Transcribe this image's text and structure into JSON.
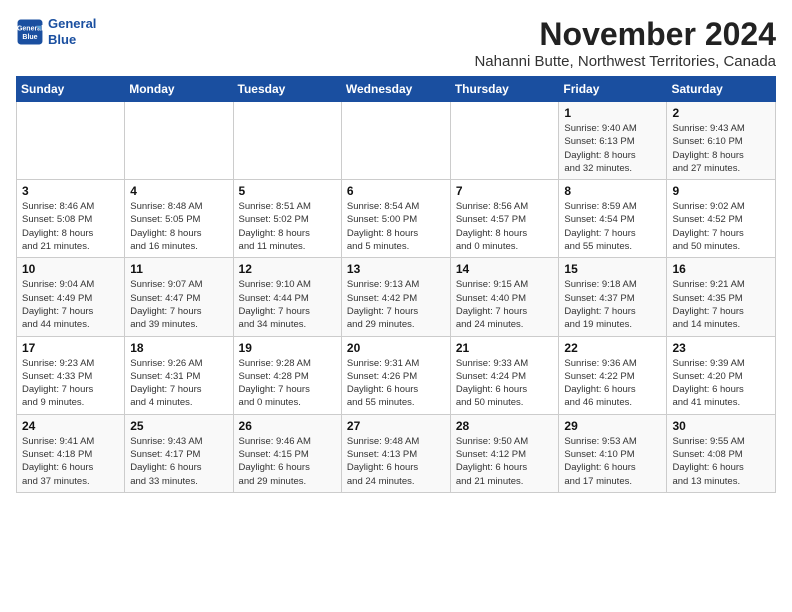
{
  "logo": {
    "line1": "General",
    "line2": "Blue"
  },
  "title": "November 2024",
  "subtitle": "Nahanni Butte, Northwest Territories, Canada",
  "weekdays": [
    "Sunday",
    "Monday",
    "Tuesday",
    "Wednesday",
    "Thursday",
    "Friday",
    "Saturday"
  ],
  "weeks": [
    [
      {
        "day": "",
        "info": ""
      },
      {
        "day": "",
        "info": ""
      },
      {
        "day": "",
        "info": ""
      },
      {
        "day": "",
        "info": ""
      },
      {
        "day": "",
        "info": ""
      },
      {
        "day": "1",
        "info": "Sunrise: 9:40 AM\nSunset: 6:13 PM\nDaylight: 8 hours\nand 32 minutes."
      },
      {
        "day": "2",
        "info": "Sunrise: 9:43 AM\nSunset: 6:10 PM\nDaylight: 8 hours\nand 27 minutes."
      }
    ],
    [
      {
        "day": "3",
        "info": "Sunrise: 8:46 AM\nSunset: 5:08 PM\nDaylight: 8 hours\nand 21 minutes."
      },
      {
        "day": "4",
        "info": "Sunrise: 8:48 AM\nSunset: 5:05 PM\nDaylight: 8 hours\nand 16 minutes."
      },
      {
        "day": "5",
        "info": "Sunrise: 8:51 AM\nSunset: 5:02 PM\nDaylight: 8 hours\nand 11 minutes."
      },
      {
        "day": "6",
        "info": "Sunrise: 8:54 AM\nSunset: 5:00 PM\nDaylight: 8 hours\nand 5 minutes."
      },
      {
        "day": "7",
        "info": "Sunrise: 8:56 AM\nSunset: 4:57 PM\nDaylight: 8 hours\nand 0 minutes."
      },
      {
        "day": "8",
        "info": "Sunrise: 8:59 AM\nSunset: 4:54 PM\nDaylight: 7 hours\nand 55 minutes."
      },
      {
        "day": "9",
        "info": "Sunrise: 9:02 AM\nSunset: 4:52 PM\nDaylight: 7 hours\nand 50 minutes."
      }
    ],
    [
      {
        "day": "10",
        "info": "Sunrise: 9:04 AM\nSunset: 4:49 PM\nDaylight: 7 hours\nand 44 minutes."
      },
      {
        "day": "11",
        "info": "Sunrise: 9:07 AM\nSunset: 4:47 PM\nDaylight: 7 hours\nand 39 minutes."
      },
      {
        "day": "12",
        "info": "Sunrise: 9:10 AM\nSunset: 4:44 PM\nDaylight: 7 hours\nand 34 minutes."
      },
      {
        "day": "13",
        "info": "Sunrise: 9:13 AM\nSunset: 4:42 PM\nDaylight: 7 hours\nand 29 minutes."
      },
      {
        "day": "14",
        "info": "Sunrise: 9:15 AM\nSunset: 4:40 PM\nDaylight: 7 hours\nand 24 minutes."
      },
      {
        "day": "15",
        "info": "Sunrise: 9:18 AM\nSunset: 4:37 PM\nDaylight: 7 hours\nand 19 minutes."
      },
      {
        "day": "16",
        "info": "Sunrise: 9:21 AM\nSunset: 4:35 PM\nDaylight: 7 hours\nand 14 minutes."
      }
    ],
    [
      {
        "day": "17",
        "info": "Sunrise: 9:23 AM\nSunset: 4:33 PM\nDaylight: 7 hours\nand 9 minutes."
      },
      {
        "day": "18",
        "info": "Sunrise: 9:26 AM\nSunset: 4:31 PM\nDaylight: 7 hours\nand 4 minutes."
      },
      {
        "day": "19",
        "info": "Sunrise: 9:28 AM\nSunset: 4:28 PM\nDaylight: 7 hours\nand 0 minutes."
      },
      {
        "day": "20",
        "info": "Sunrise: 9:31 AM\nSunset: 4:26 PM\nDaylight: 6 hours\nand 55 minutes."
      },
      {
        "day": "21",
        "info": "Sunrise: 9:33 AM\nSunset: 4:24 PM\nDaylight: 6 hours\nand 50 minutes."
      },
      {
        "day": "22",
        "info": "Sunrise: 9:36 AM\nSunset: 4:22 PM\nDaylight: 6 hours\nand 46 minutes."
      },
      {
        "day": "23",
        "info": "Sunrise: 9:39 AM\nSunset: 4:20 PM\nDaylight: 6 hours\nand 41 minutes."
      }
    ],
    [
      {
        "day": "24",
        "info": "Sunrise: 9:41 AM\nSunset: 4:18 PM\nDaylight: 6 hours\nand 37 minutes."
      },
      {
        "day": "25",
        "info": "Sunrise: 9:43 AM\nSunset: 4:17 PM\nDaylight: 6 hours\nand 33 minutes."
      },
      {
        "day": "26",
        "info": "Sunrise: 9:46 AM\nSunset: 4:15 PM\nDaylight: 6 hours\nand 29 minutes."
      },
      {
        "day": "27",
        "info": "Sunrise: 9:48 AM\nSunset: 4:13 PM\nDaylight: 6 hours\nand 24 minutes."
      },
      {
        "day": "28",
        "info": "Sunrise: 9:50 AM\nSunset: 4:12 PM\nDaylight: 6 hours\nand 21 minutes."
      },
      {
        "day": "29",
        "info": "Sunrise: 9:53 AM\nSunset: 4:10 PM\nDaylight: 6 hours\nand 17 minutes."
      },
      {
        "day": "30",
        "info": "Sunrise: 9:55 AM\nSunset: 4:08 PM\nDaylight: 6 hours\nand 13 minutes."
      }
    ]
  ]
}
